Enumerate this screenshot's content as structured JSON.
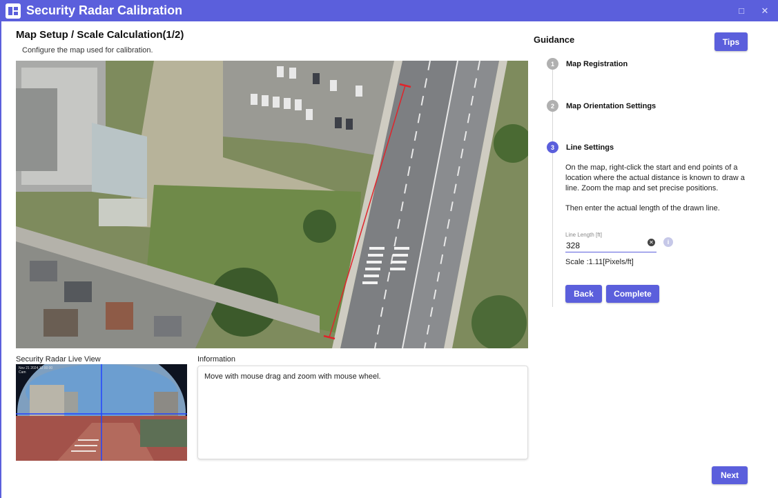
{
  "window": {
    "title": "Security Radar Calibration",
    "maximize_glyph": "□",
    "close_glyph": "✕"
  },
  "page": {
    "title": "Map Setup / Scale Calculation(1/2)",
    "subtitle": "Configure the map used for calibration."
  },
  "map": {
    "icon": "satellite-map",
    "line_color": "#e0242b"
  },
  "live_view": {
    "label": "Security Radar Live View",
    "overlay_text": "Nov 21 2024 12:00:00  Cam"
  },
  "information": {
    "label": "Information",
    "text": "Move with mouse drag and zoom with mouse wheel."
  },
  "guidance": {
    "title": "Guidance",
    "tips_label": "Tips",
    "steps": [
      {
        "num": "1",
        "label": "Map Registration",
        "state": "done"
      },
      {
        "num": "2",
        "label": "Map Orientation Settings",
        "state": "done"
      },
      {
        "num": "3",
        "label": "Line Settings",
        "state": "active"
      }
    ],
    "description": "On the map, right-click the start and end points of a location where the actual distance is known to draw a line. Zoom the map and set precise positions.",
    "description2": "Then enter the actual length of the drawn line.",
    "line_length": {
      "label": "Line Length [ft]",
      "value": "328"
    },
    "scale": "Scale :1.11[Pixels/ft]",
    "back_label": "Back",
    "complete_label": "Complete"
  },
  "footer": {
    "next_label": "Next"
  },
  "colors": {
    "accent": "#5b5fdc",
    "step_inactive": "#b0b0b0"
  }
}
